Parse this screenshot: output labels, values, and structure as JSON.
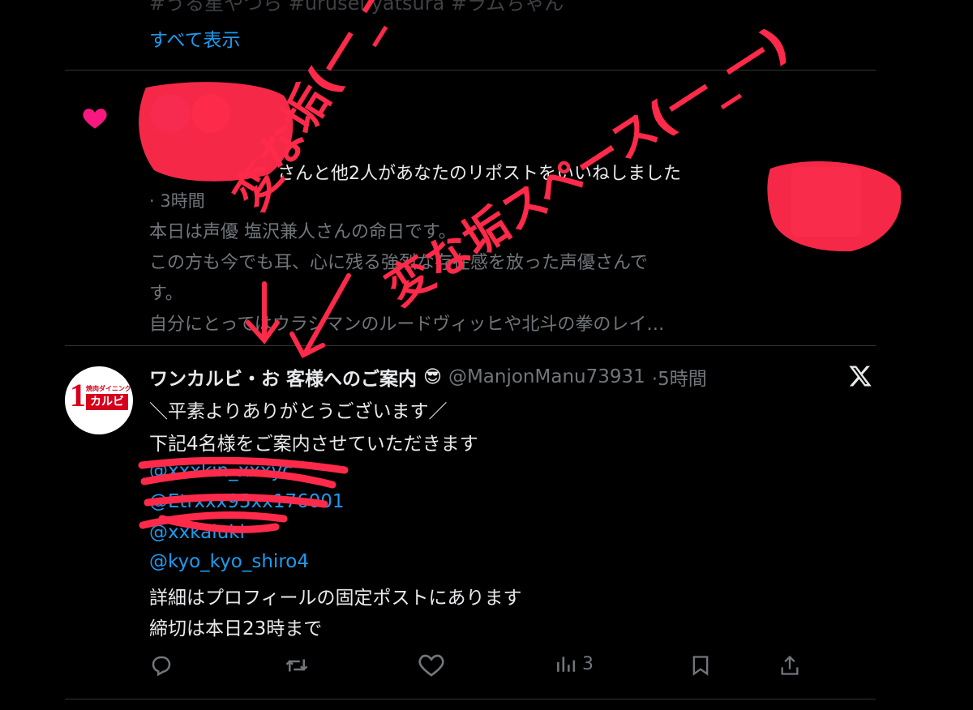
{
  "top_post": {
    "hashtags_partial": "#うる星やつら #urusei yatsura #ラムちゃん",
    "show_all_link": "すべて表示"
  },
  "like_notification": {
    "summary": "さんと他2人があなたのリポストをいいねしました",
    "time": "· 3時間",
    "body_lines": [
      "本日は声優 塩沢兼人さんの命日です。",
      "この方も今でも耳、心に残る強烈な存在感を放った声優さんで",
      "す。",
      "自分にとってはウラシマンのルードヴィッヒや北斗の拳のレイ…"
    ]
  },
  "tweet": {
    "display_name": "ワンカルビ・お 客様へのご案内",
    "emoji": "😎",
    "handle": "@ManjonManu73931",
    "time": "·5時間",
    "avatar_small_text": "焼肉ダイニング",
    "avatar_brand_text": "カルビ",
    "avatar_numeral": "1",
    "line1": "＼平素よりありがとうございます／",
    "line2": "下記4名様をご案内させていただきます",
    "mentions": [
      "@xxxkin_xxxyc",
      "@Etrxxx95xx176001",
      "@xxkaiuki",
      "@kyo_kyo_shiro4"
    ],
    "line3": "詳細はプロフィールの固定ポストにあります",
    "line4": "締切は本日23時まで",
    "views_count": "3"
  },
  "annotations": {
    "text_left": "変な垢(一_一)",
    "text_right": "変な垢スペース(一_一)"
  },
  "colors": {
    "background": "#000000",
    "text": "#e7e9ea",
    "muted": "#71767b",
    "link": "#1d9bf0",
    "like_heart": "#f91880",
    "scribble": "#ff2a4a"
  }
}
